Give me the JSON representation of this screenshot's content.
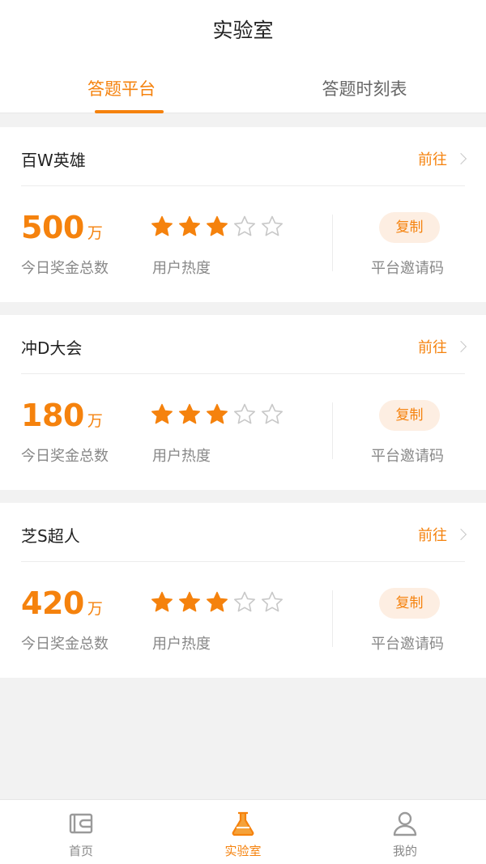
{
  "header": {
    "title": "实验室"
  },
  "tabs": [
    {
      "label": "答题平台",
      "active": true
    },
    {
      "label": "答题时刻表",
      "active": false
    }
  ],
  "platforms": [
    {
      "name": "百W英雄",
      "goto": "前往",
      "amount": "500",
      "unit": "万",
      "prize_label": "今日奖金总数",
      "stars_filled": 3,
      "stars_total": 5,
      "heat_label": "用户热度",
      "copy_label": "复制",
      "code_label": "平台邀请码"
    },
    {
      "name": "冲D大会",
      "goto": "前往",
      "amount": "180",
      "unit": "万",
      "prize_label": "今日奖金总数",
      "stars_filled": 3,
      "stars_total": 5,
      "heat_label": "用户热度",
      "copy_label": "复制",
      "code_label": "平台邀请码"
    },
    {
      "name": "芝S超人",
      "goto": "前往",
      "amount": "420",
      "unit": "万",
      "prize_label": "今日奖金总数",
      "stars_filled": 3,
      "stars_total": 5,
      "heat_label": "用户热度",
      "copy_label": "复制",
      "code_label": "平台邀请码"
    }
  ],
  "bottom_nav": [
    {
      "label": "首页",
      "icon": "wallet-icon",
      "active": false
    },
    {
      "label": "实验室",
      "icon": "flask-icon",
      "active": true
    },
    {
      "label": "我的",
      "icon": "user-icon",
      "active": false
    }
  ],
  "colors": {
    "accent": "#f5820d",
    "accent_light": "#fdeee2",
    "star_empty": "#c8c8c8"
  }
}
